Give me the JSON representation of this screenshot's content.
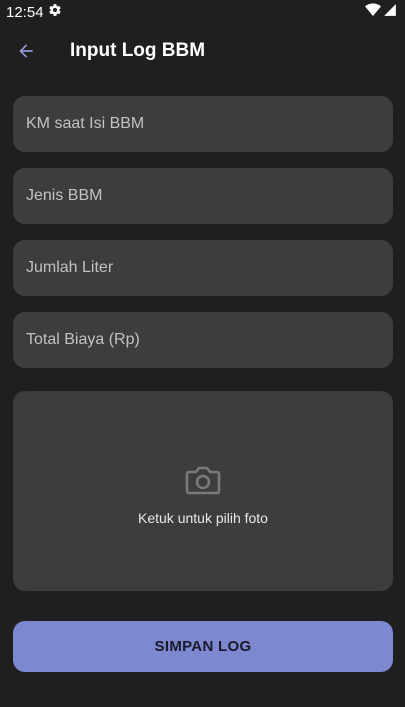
{
  "status_bar": {
    "time": "12:54",
    "settings_icon": "gear-icon",
    "wifi_icon": "wifi-icon",
    "signal_icon": "signal-icon"
  },
  "app_bar": {
    "back_icon": "arrow-back-icon",
    "title": "Input Log BBM"
  },
  "form": {
    "km_placeholder": "KM saat Isi BBM",
    "km_value": "",
    "fuel_type_placeholder": "Jenis BBM",
    "fuel_type_value": "",
    "liters_placeholder": "Jumlah Liter",
    "liters_value": "",
    "total_cost_placeholder": "Total Biaya (Rp)",
    "total_cost_value": "",
    "photo_icon": "camera-icon",
    "photo_label": "Ketuk untuk pilih foto",
    "submit_label": "SIMPAN LOG"
  },
  "colors": {
    "background": "#1f1f1f",
    "field_background": "#3d3d3d",
    "accent": "#7c88cf",
    "back_arrow": "#8f9ae0"
  }
}
